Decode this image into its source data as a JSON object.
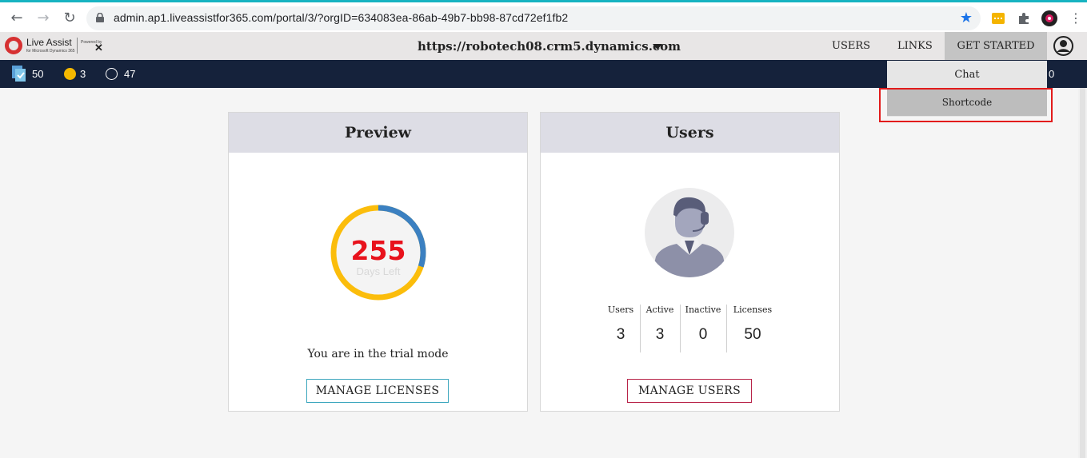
{
  "browser": {
    "url": "admin.ap1.liveassistfor365.com/portal/3/?orgID=634083ea-86ab-49b7-bb98-87cd72ef1fb2",
    "icons": [
      "back-icon",
      "forward-icon",
      "reload-icon",
      "lock-icon",
      "star-icon",
      "extension-icon",
      "puzzle-icon",
      "profile-icon",
      "menu-icon"
    ]
  },
  "header": {
    "logo_text": "Live Assist",
    "logo_sub": "for Microsoft Dynamics 365",
    "logo_powered": "Powered by",
    "logo_brand": "CAFÉX",
    "org_url": "https://robotech08.crm5.dynamics.com",
    "nav": {
      "users": "USERS",
      "links": "LINKS",
      "get_started": "GET STARTED"
    }
  },
  "status_bar": {
    "licenses": "50",
    "active": "3",
    "inactive": "47",
    "right_value": "0",
    "colors": {
      "active": "#f5b800",
      "bar": "#15223b"
    }
  },
  "dropdown": {
    "items": [
      {
        "label": "Chat"
      },
      {
        "label": "Shortcode"
      }
    ]
  },
  "preview_card": {
    "title": "Preview",
    "days_left": "255",
    "days_left_label": "Days Left",
    "trial_text": "You are in the trial mode",
    "button": "MANAGE LICENSES",
    "gauge_fraction_used": 0.3,
    "colors": {
      "gauge_main": "#fbbd0b",
      "gauge_accent": "#3b80c1",
      "number": "#e8121c"
    }
  },
  "users_card": {
    "title": "Users",
    "stats": [
      {
        "label": "Users",
        "value": "3"
      },
      {
        "label": "Active",
        "value": "3"
      },
      {
        "label": "Inactive",
        "value": "0"
      },
      {
        "label": "Licenses",
        "value": "50"
      }
    ],
    "button": "MANAGE USERS"
  }
}
